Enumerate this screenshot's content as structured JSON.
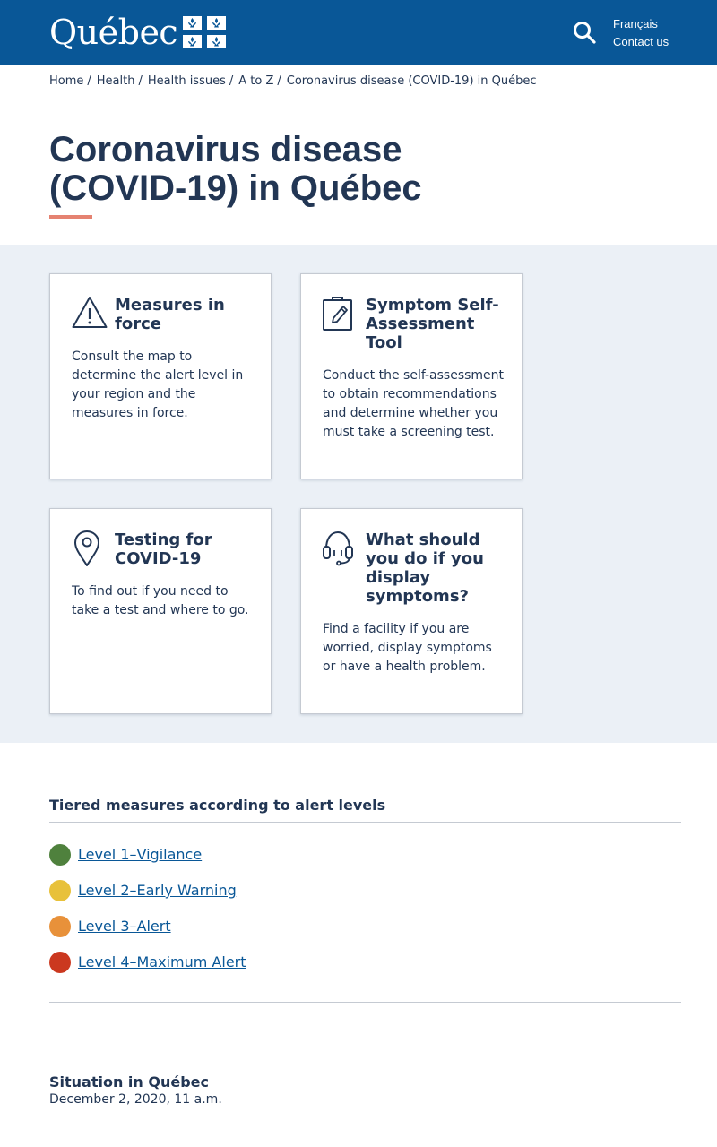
{
  "header": {
    "logo_text": "Québec",
    "links": [
      "Français",
      "Contact us"
    ],
    "colors": {
      "background": "#095797",
      "text": "#ffffff"
    }
  },
  "breadcrumb": [
    "Home",
    "Health",
    "Health issues",
    "A to Z",
    "Coronavirus disease (COVID-19) in Québec"
  ],
  "page": {
    "title": "Coronavirus disease (COVID-19) in Québec",
    "accent_color": "#e58271"
  },
  "cards": [
    {
      "icon": "warning-icon",
      "title": "Measures in force",
      "description": "Consult the map to determine the alert level in your region and the measures in force."
    },
    {
      "icon": "clipboard-pen-icon",
      "title": "Symptom Self-Assessment Tool",
      "description": "Conduct the self-assessment to obtain recommendations and determine whether you must take a screening test."
    },
    {
      "icon": "map-pin-icon",
      "title": "Testing for COVID-19",
      "description": "To find out if you need to take a test and where to go."
    },
    {
      "icon": "headset-icon",
      "title": "What should you do if you display symptoms?",
      "description": "Find a facility if you are worried, display symptoms or have a health problem."
    }
  ],
  "alert_levels": {
    "heading": "Tiered measures according to alert levels",
    "levels": [
      {
        "label": "Level 1–Vigilance",
        "color": "#4f813d"
      },
      {
        "label": "Level 2–Early Warning",
        "color": "#e8c13a"
      },
      {
        "label": "Level 3–Alert",
        "color": "#e8913a"
      },
      {
        "label": "Level 4–Maximum Alert",
        "color": "#cb381f"
      }
    ]
  },
  "situation": {
    "heading": "Situation in Québec",
    "date": "December 2, 2020, 11 a.m."
  }
}
